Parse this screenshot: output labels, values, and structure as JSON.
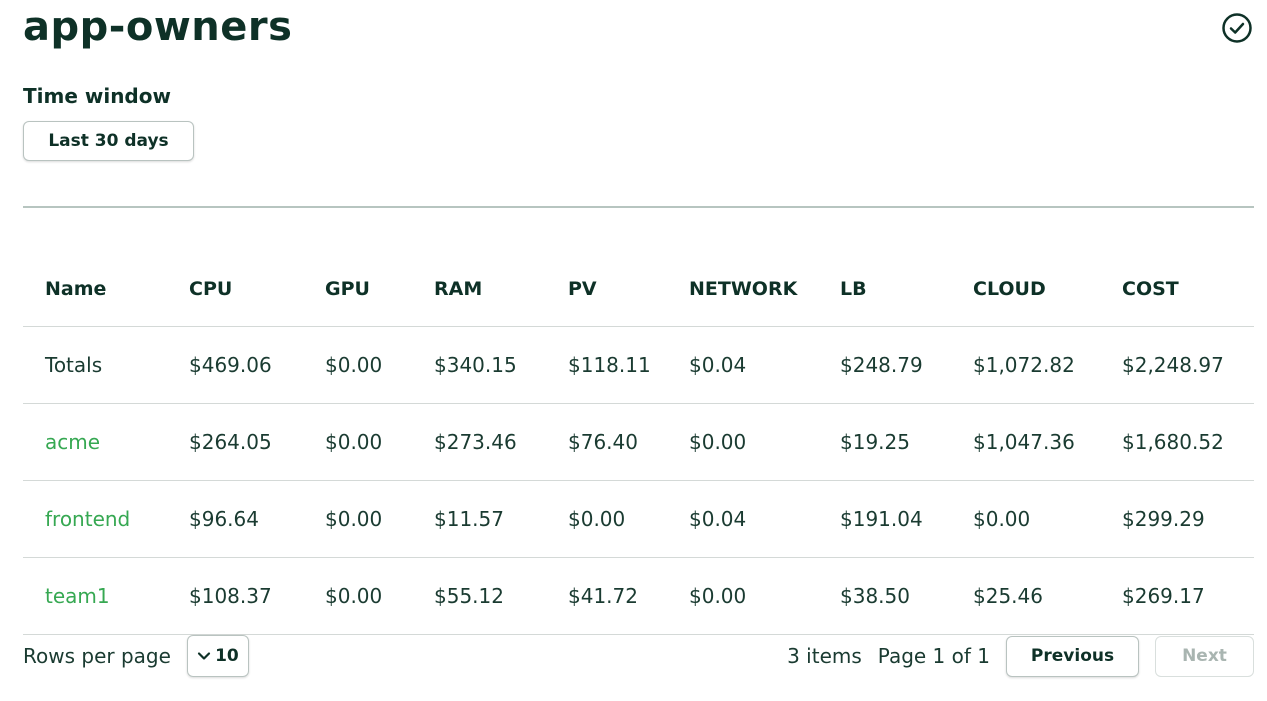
{
  "page": {
    "title": "app-owners"
  },
  "time_window": {
    "label": "Time window",
    "selected": "Last 30 days"
  },
  "table": {
    "columns": [
      "Name",
      "CPU",
      "GPU",
      "RAM",
      "PV",
      "NETWORK",
      "LB",
      "CLOUD",
      "COST"
    ],
    "totals": {
      "name": "Totals",
      "values": [
        "$469.06",
        "$0.00",
        "$340.15",
        "$118.11",
        "$0.04",
        "$248.79",
        "$1,072.82",
        "$2,248.97"
      ]
    },
    "rows": [
      {
        "name": "acme",
        "values": [
          "$264.05",
          "$0.00",
          "$273.46",
          "$76.40",
          "$0.00",
          "$19.25",
          "$1,047.36",
          "$1,680.52"
        ]
      },
      {
        "name": "frontend",
        "values": [
          "$96.64",
          "$0.00",
          "$11.57",
          "$0.00",
          "$0.04",
          "$191.04",
          "$0.00",
          "$299.29"
        ]
      },
      {
        "name": "team1",
        "values": [
          "$108.37",
          "$0.00",
          "$55.12",
          "$41.72",
          "$0.00",
          "$38.50",
          "$25.46",
          "$269.17"
        ]
      }
    ]
  },
  "pagination": {
    "rows_per_page_label": "Rows per page",
    "rows_per_page_value": "10",
    "items_count": "3 items",
    "page_info": "Page 1 of 1",
    "previous_label": "Previous",
    "next_label": "Next"
  },
  "icons": {
    "status": "check-circle-icon",
    "rows_per_page_dropdown": "chevron-down-icon"
  },
  "colors": {
    "text_primary": "#0e3127",
    "link_green": "#36a852",
    "border": "#b9c3c0",
    "disabled_text": "#a9b5b1"
  }
}
